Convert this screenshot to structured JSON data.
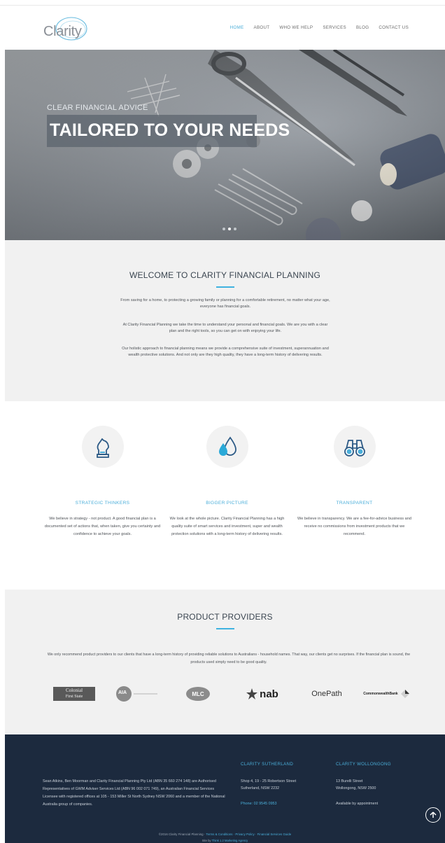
{
  "header": {
    "logo_text": "Clarity",
    "nav": [
      "HOME",
      "ABOUT",
      "WHO WE HELP",
      "SERVICES",
      "BLOG",
      "CONTACT US"
    ],
    "active_index": 0
  },
  "hero": {
    "subtitle": "CLEAR FINANCIAL ADVICE",
    "title": "TAILORED TO YOUR NEEDS",
    "slides": 3,
    "active_slide": 1
  },
  "welcome": {
    "heading": "WELCOME TO CLARITY FINANCIAL PLANNING",
    "paragraphs": [
      "From saving for a home, to protecting a growing family or planning for a comfortable retirement, no matter what your age, everyone has financial goals.",
      "At Clarity Financial Planning we take the time to understand your personal and financial goals. We are you with a clear plan and the right tools, so you can get on with enjoying your life.",
      "Our holistic approach to financial planning means we provide a comprehensive suite of investment, superannuation and wealth protective solutions. And not only are they high quality, they have a long-term history of delivering results."
    ]
  },
  "features": [
    {
      "icon": "chess-knight-icon",
      "title": "STRATEGIC THINKERS",
      "text": "We believe in strategy - not product. A good financial plan is a documented set of actions that, when taken, give you certainty and confidence to achieve your goals."
    },
    {
      "icon": "water-drops-icon",
      "title": "BIGGER PICTURE",
      "text": "We look at the whole picture. Clarity Financial Planning has a high quality suite of smart services and investment, super and wealth protection solutions with a long-term history of delivering results."
    },
    {
      "icon": "binoculars-icon",
      "title": "TRANSPARENT",
      "text": "We believe in transparency. We are a fee-for-advice business and receive no commissions from investment products that we recommend."
    }
  ],
  "providers": {
    "heading": "PRODUCT PROVIDERS",
    "text": "We only recommend product providers to our clients that have a long-term history of providing reliable solutions to Australians - household names. That way, our clients get no surprises. If the financial plan is sound, the products used simply need to be good quality.",
    "logos": {
      "colonial_line1": "Colonial",
      "colonial_line2": "First State",
      "aia": "AIA",
      "mlc": "MLC",
      "nab": "nab",
      "onepath": "OnePath",
      "cba": "CommonwealthBank"
    }
  },
  "footer": {
    "about": "Sean Atkins, Ben Moorman and Clarity Financial Planning Pty Ltd (ABN 35 660 274 148) are Authorised Representatives of GWM Adviser Services Ltd (ABN 96 002 071 749), an Australian Financial Services Licensee with registered offices at 105 - 153 Miller St North Sydney NSW 2060 and a member of the National Australia group of companies.",
    "sutherland": {
      "title": "CLARITY SUTHERLAND",
      "line1": "Shop 4, 19 - 25 Robertson Street",
      "line2": "Sutherland, NSW 2232",
      "phone": "Phone: 02 9545 0953"
    },
    "wollongong": {
      "title": "CLARITY WOLLONGONG",
      "line1": "13 Burelli Street",
      "line2": "Wollongong, NSW 2500",
      "avail": "Available by appointment"
    },
    "copyright_prefix": "©2016 Clarity Financial Planning · ",
    "copyright_links": "Terms & Conditions · Privacy Policy · Financial Services Guide",
    "madeby_prefix": "Site by ",
    "madeby_link": "Think 1.2 Marketing Agency"
  },
  "colors": {
    "accent": "#4aaed9",
    "footer_bg": "#1c2a3e",
    "section_gray": "#f1f1f1"
  }
}
